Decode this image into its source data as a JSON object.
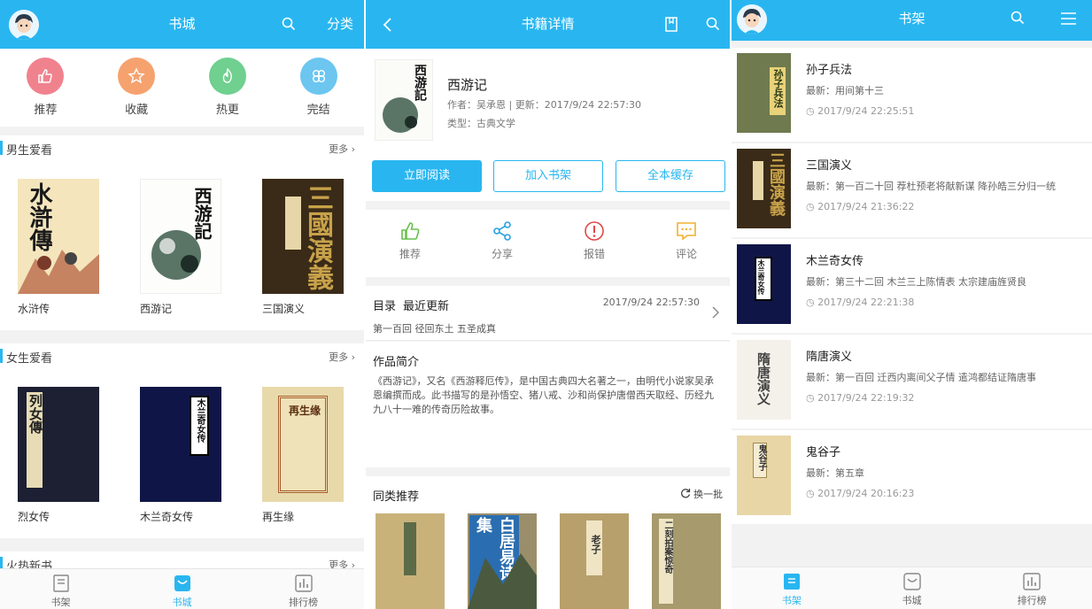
{
  "store": {
    "title": "书城",
    "category_tab": "分类",
    "quick": [
      {
        "label": "推荐",
        "color": "#f0828e",
        "icon": "thumbs-up-icon"
      },
      {
        "label": "收藏",
        "color": "#f6a26f",
        "icon": "star-icon"
      },
      {
        "label": "热更",
        "color": "#6fd08f",
        "icon": "flame-icon"
      },
      {
        "label": "完结",
        "color": "#6cc6f0",
        "icon": "clover-icon"
      }
    ],
    "sections": [
      {
        "title": "男生爱看",
        "more": "更多",
        "books": [
          "水浒传",
          "西游记",
          "三国演义"
        ]
      },
      {
        "title": "女生爱看",
        "more": "更多",
        "books": [
          "烈女传",
          "木兰奇女传",
          "再生缘"
        ]
      },
      {
        "title": "火热新书",
        "more": "更多"
      }
    ]
  },
  "detail": {
    "title": "书籍详情",
    "book_title": "西游记",
    "meta_line": "作者：吴承恩 | 更新：2017/9/24 22:57:30",
    "type_line": "类型：古典文学",
    "buttons": {
      "read": "立即阅读",
      "add": "加入书架",
      "cache": "全本缓存"
    },
    "actions": [
      "推荐",
      "分享",
      "报错",
      "评论"
    ],
    "catalog_label": "目录",
    "recent_label": "最近更新",
    "catalog_time": "2017/9/24 22:57:30",
    "latest_chapter": "第一百回 径回东土 五圣成真",
    "intro_title": "作品简介",
    "intro_text": "《西游记》，又名《西游释厄传》，是中国古典四大名著之一，由明代小说家吴承恩编撰而成。此书描写的是孙悟空、猪八戒、沙和尚保护唐僧西天取经、历经九九八十一难的传奇历险故事。",
    "similar_title": "同类推荐",
    "refresh_label": "换一批"
  },
  "shelf": {
    "title": "书架",
    "books": [
      {
        "title": "孙子兵法",
        "latest": "最新：用间第十三",
        "time": "2017/9/24 22:25:51"
      },
      {
        "title": "三国演义",
        "latest": "最新：第一百二十回 荐杜预老将献新谋 降孙皓三分归一统",
        "time": "2017/9/24 21:36:22"
      },
      {
        "title": "木兰奇女传",
        "latest": "最新：第三十二回 木兰三上陈情表 太宗建庙旌贤良",
        "time": "2017/9/24 22:21:38"
      },
      {
        "title": "隋唐演义",
        "latest": "最新：第一百回 迁西内离间父子情 遣鸿都结证隋唐事",
        "time": "2017/9/24 22:19:32"
      },
      {
        "title": "鬼谷子",
        "latest": "最新：第五章",
        "time": "2017/9/24 20:16:23"
      }
    ]
  },
  "nav": {
    "shelf": "书架",
    "store": "书城",
    "rank": "排行榜"
  },
  "colors": {
    "accent": "#29b6f0"
  }
}
